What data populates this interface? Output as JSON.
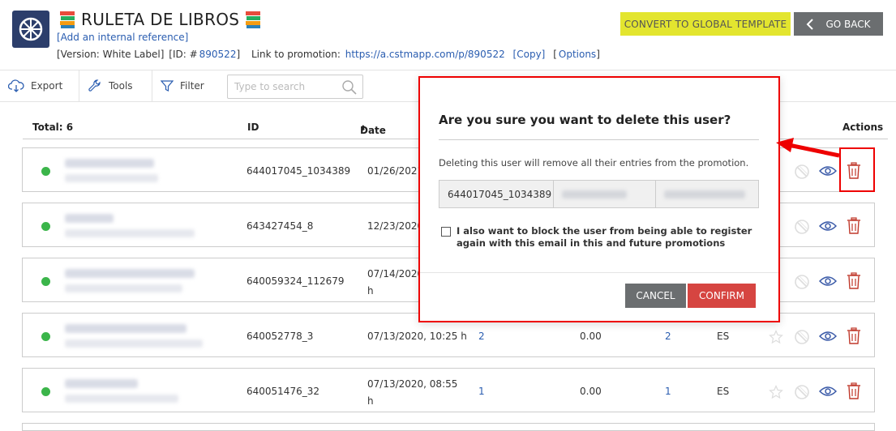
{
  "header": {
    "title": "RULETA DE LIBROS",
    "internal_ref": "[Add an internal reference]",
    "version": "[Version: White Label]",
    "id_prefix": "[ID: #",
    "id_value": "890522",
    "id_suffix": "]",
    "link_label": "Link to promotion:",
    "link_url": "https://a.cstmapp.com/p/890522",
    "copy": "[Copy]",
    "options_open": "[",
    "options": "Options",
    "options_close": "]",
    "convert_button": "CONVERT TO GLOBAL TEMPLATE",
    "back_button": "GO BACK"
  },
  "toolbar": {
    "export": "Export",
    "tools": "Tools",
    "filter": "Filter",
    "search_placeholder": "Type to search"
  },
  "table": {
    "total": "Total: 6",
    "col_id": "ID",
    "col_date": "Date",
    "col_actions": "Actions",
    "rows": [
      {
        "id": "644017045_1034389",
        "date": "01/26/2021",
        "c1": "",
        "c2": "",
        "c3": "",
        "lang": ""
      },
      {
        "id": "643427454_8",
        "date": "12/23/2020",
        "c1": "",
        "c2": "",
        "c3": "",
        "lang": ""
      },
      {
        "id": "640059324_112679",
        "date": "07/14/2020",
        "date2": "h",
        "c1": "",
        "c2": "",
        "c3": "",
        "lang": ""
      },
      {
        "id": "640052778_3",
        "date": "07/13/2020, 10:25 h",
        "c1": "2",
        "c2": "0.00",
        "c3": "2",
        "lang": "ES"
      },
      {
        "id": "640051476_32",
        "date": "07/13/2020, 08:55",
        "date2": "h",
        "c1": "1",
        "c2": "0.00",
        "c3": "1",
        "lang": "ES"
      }
    ]
  },
  "modal": {
    "title": "Are you sure you want to delete this user?",
    "text": "Deleting this user will remove all their entries from the promotion.",
    "user_id": "644017045_1034389",
    "checkbox_label": "I also want to block the user from being able to register again with this email in this and future promotions",
    "cancel": "CANCEL",
    "confirm": "CONFIRM"
  },
  "colors": {
    "accent_yellow": "#e3e52f",
    "danger": "#d64541",
    "status_active": "#3bb54a",
    "highlight": "#e00000"
  }
}
